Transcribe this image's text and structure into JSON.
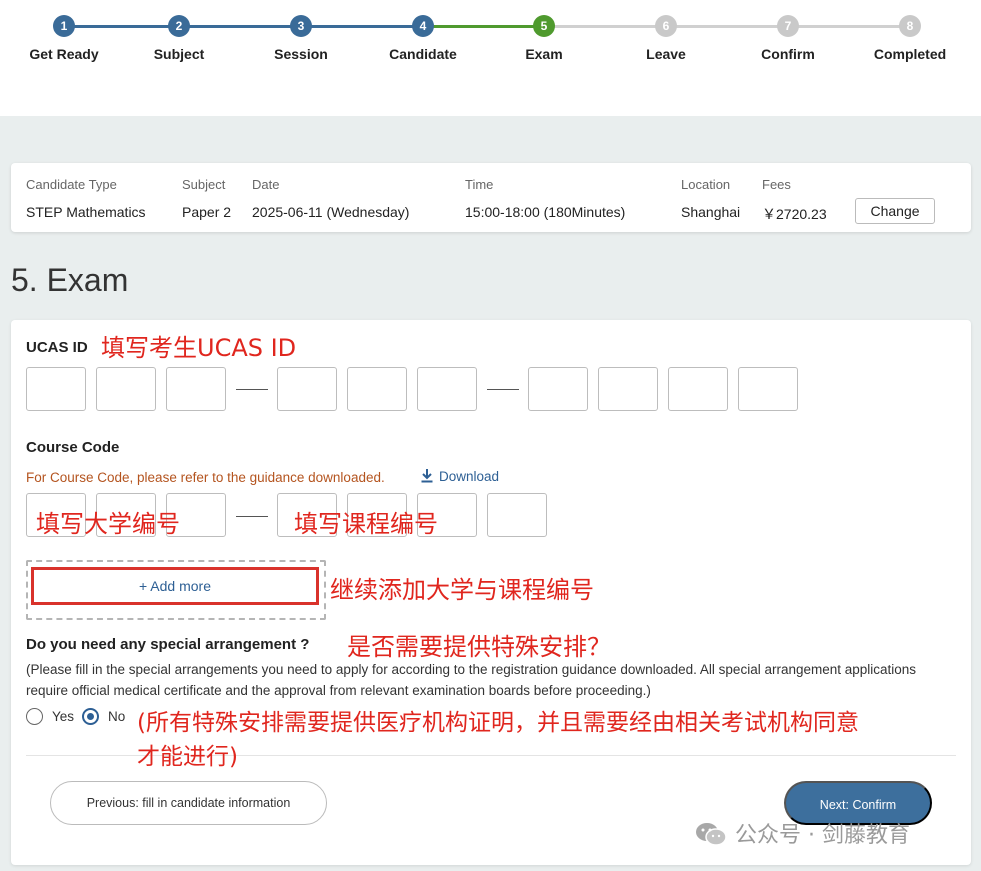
{
  "stepper": {
    "steps": [
      {
        "number": "1",
        "label": "Get Ready",
        "state": "done"
      },
      {
        "number": "2",
        "label": "Subject",
        "state": "done"
      },
      {
        "number": "3",
        "label": "Session",
        "state": "done"
      },
      {
        "number": "4",
        "label": "Candidate",
        "state": "done"
      },
      {
        "number": "5",
        "label": "Exam",
        "state": "current"
      },
      {
        "number": "6",
        "label": "Leave",
        "state": "todo"
      },
      {
        "number": "7",
        "label": "Confirm",
        "state": "todo"
      },
      {
        "number": "8",
        "label": "Completed",
        "state": "todo"
      }
    ],
    "colors": {
      "done": "#3a6b98",
      "current": "#4f9a2e",
      "todo": "#c9c9c9"
    }
  },
  "summary": {
    "candidate_type": {
      "label": "Candidate Type",
      "value": "STEP Mathematics"
    },
    "subject": {
      "label": "Subject",
      "value": "Paper 2"
    },
    "date": {
      "label": "Date",
      "value": "2025-06-11 (Wednesday)"
    },
    "time": {
      "label": "Time",
      "value": "15:00-18:00 (180Minutes)"
    },
    "location": {
      "label": "Location",
      "value": "Shanghai"
    },
    "fees": {
      "label": "Fees",
      "value": "￥2720.23"
    },
    "change_label": "Change"
  },
  "page": {
    "heading": "5. Exam"
  },
  "ucas": {
    "label": "UCAS ID"
  },
  "course_code": {
    "label": "Course Code",
    "hint": "For Course Code, please refer to the guidance downloaded.",
    "download_label": "Download"
  },
  "add_more": {
    "label": "+ Add more"
  },
  "special": {
    "question": "Do you need any special arrangement ?",
    "description": "(Please fill in the special arrangements you need to apply for according to the registration guidance downloaded. All special arrangement applications require official medical certificate and the approval from relevant examination boards before proceeding.)",
    "options": [
      {
        "label": "Yes",
        "selected": false
      },
      {
        "label": "No",
        "selected": true
      }
    ]
  },
  "nav": {
    "prev_label": "Previous: fill in candidate information",
    "next_label": "Next: Confirm"
  },
  "annotations": {
    "ucas": "填写考生UCAS ID",
    "university_code": "填写大学编号",
    "course_code": "填写课程编号",
    "add_more": "继续添加大学与课程编号",
    "special": "是否需要提供特殊安排？",
    "special_note_line1": "(所有特殊安排需要提供医疗机构证明，并且需要经由相关考试机构同意",
    "special_note_line2": "才能进行)"
  },
  "watermark": {
    "text": "公众号 · 剑藤教育"
  }
}
